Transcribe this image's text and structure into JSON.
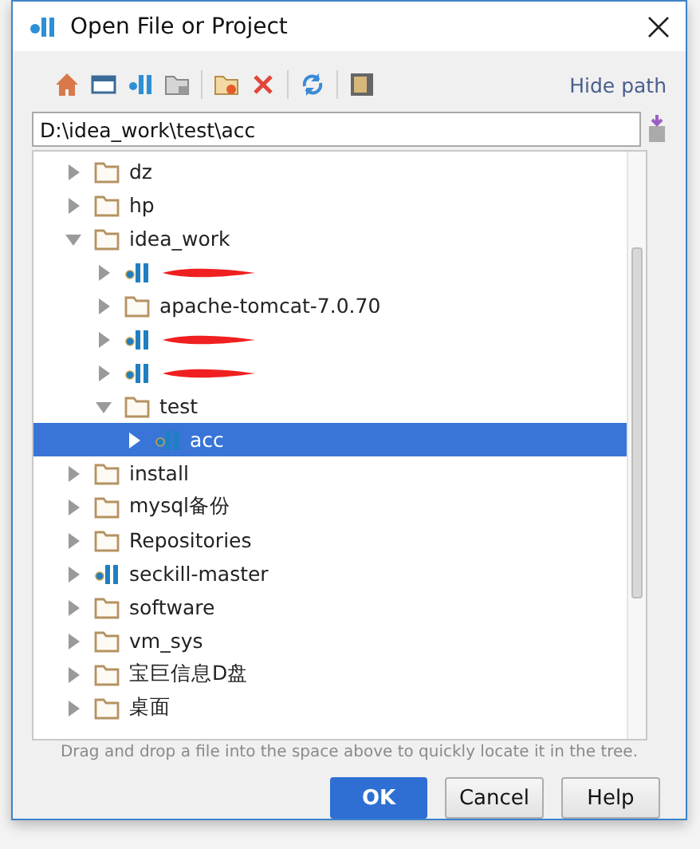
{
  "window": {
    "title": "Open File or Project"
  },
  "toolbar": {
    "link": "Hide path"
  },
  "path_field": {
    "value": "D:\\idea_work\\test\\acc"
  },
  "tree": [
    {
      "name": "dz",
      "kind": "folder",
      "expanded": false,
      "selected": false
    },
    {
      "name": "hp",
      "kind": "folder",
      "expanded": false,
      "selected": false
    },
    {
      "name": "idea_work",
      "kind": "folder",
      "expanded": true,
      "selected": false,
      "children": [
        {
          "kind": "project",
          "redacted": true,
          "expanded": false,
          "selected": false
        },
        {
          "name": "apache-tomcat-7.0.70",
          "kind": "folder",
          "expanded": false,
          "selected": false
        },
        {
          "kind": "project",
          "redacted": true,
          "expanded": false,
          "selected": false
        },
        {
          "kind": "project",
          "redacted": true,
          "expanded": false,
          "selected": false
        },
        {
          "name": "test",
          "kind": "folder",
          "expanded": true,
          "selected": false,
          "children": [
            {
              "name": "acc",
              "kind": "project",
              "expanded": false,
              "selected": true
            }
          ]
        }
      ]
    },
    {
      "name": "install",
      "kind": "folder",
      "expanded": false,
      "selected": false
    },
    {
      "name": "mysql备份",
      "kind": "folder",
      "expanded": false,
      "selected": false
    },
    {
      "name": "Repositories",
      "kind": "folder",
      "expanded": false,
      "selected": false
    },
    {
      "name": "seckill-master",
      "kind": "project",
      "expanded": false,
      "selected": false
    },
    {
      "name": "software",
      "kind": "folder",
      "expanded": false,
      "selected": false
    },
    {
      "name": "vm_sys",
      "kind": "folder",
      "expanded": false,
      "selected": false
    },
    {
      "name": "宝巨信息D盘",
      "kind": "folder",
      "expanded": false,
      "selected": false
    },
    {
      "name": "桌面",
      "kind": "folder",
      "expanded": false,
      "selected": false
    }
  ],
  "hint": "Drag and drop a file into the space above to quickly locate it in the tree.",
  "buttons": [
    "OK",
    "Cancel",
    "Help"
  ]
}
